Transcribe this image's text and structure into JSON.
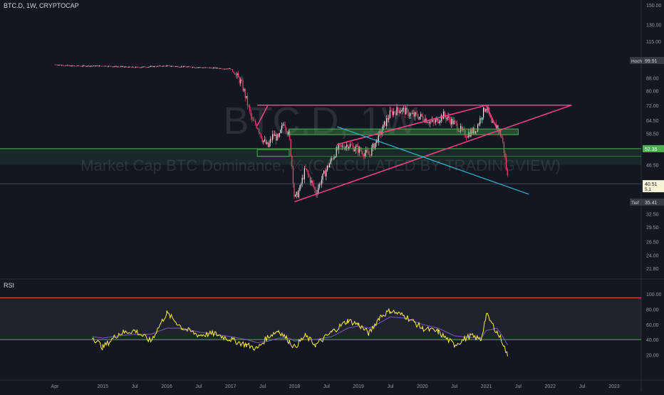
{
  "header": {
    "symbol": "BTC.D, 1W, CRYPTOCAP"
  },
  "watermark": {
    "big": "BTC.D, 1W",
    "sub": "Market Cap BTC Dominance, % (CALCULATED BY TRADINGVIEW)"
  },
  "rsi_label": "RSI",
  "price_badges": {
    "high_label": "Hoch",
    "high_value": "99.91",
    "level_value": "52.36",
    "last_value": "40.51",
    "last_extra": "5.1",
    "low_label": "Tief",
    "low_value": "35.41"
  },
  "colors": {
    "background": "#131722",
    "candle_up": "#e6e6e6",
    "candle_down": "#f6466e",
    "trendline_pink": "#ff3f8e",
    "trendline_blue": "#31b4d8",
    "support_green": "#4caf50",
    "rsi_line": "#ffeb3b",
    "rsi_ma": "#7e57c2",
    "rsi_upper": "#ff5252",
    "rsi_lower": "#4caf50"
  },
  "chart_data": [
    {
      "type": "line",
      "name": "BTC.D weekly",
      "x_ticks": [
        "Apr",
        "2015",
        "Jul",
        "2016",
        "Jul",
        "2017",
        "Jul",
        "2018",
        "Jul",
        "2019",
        "Jul",
        "2020",
        "Jul",
        "2021",
        "Jul",
        "2022",
        "Jul",
        "2023"
      ],
      "y_ticks": [
        150.0,
        130.0,
        115.0,
        99.91,
        88.0,
        80.0,
        72.0,
        64.5,
        58.5,
        52.36,
        46.5,
        40.51,
        35.41,
        32.5,
        29.5,
        26.5,
        24.0,
        21.8
      ],
      "y_scale": "log",
      "x": [
        "2014-04",
        "2014-07",
        "2015-01",
        "2015-07",
        "2016-01",
        "2016-07",
        "2017-01",
        "2017-03",
        "2017-05",
        "2017-06",
        "2017-07",
        "2017-08",
        "2017-09",
        "2017-10",
        "2017-11",
        "2017-12",
        "2018-01",
        "2018-02",
        "2018-03",
        "2018-05",
        "2018-07",
        "2018-09",
        "2018-11",
        "2019-01",
        "2019-03",
        "2019-05",
        "2019-07",
        "2019-09",
        "2019-11",
        "2020-01",
        "2020-03",
        "2020-05",
        "2020-07",
        "2020-09",
        "2020-11",
        "2021-01",
        "2021-02",
        "2021-03",
        "2021-04",
        "2021-05"
      ],
      "y": [
        97,
        96,
        96,
        95,
        96,
        95,
        94,
        85,
        64,
        62,
        56,
        53,
        58,
        56,
        64,
        57,
        36,
        39,
        45,
        38,
        45,
        52,
        54,
        52,
        50,
        58,
        68,
        70,
        67,
        66,
        63,
        67,
        63,
        58,
        60,
        72,
        62,
        62,
        56,
        42
      ],
      "resistance_top": 72,
      "zone_upper": 60.5,
      "zone_lower": 52.36,
      "grid": false
    },
    {
      "type": "line",
      "name": "RSI",
      "y_ticks": [
        100,
        80,
        60,
        40,
        20
      ],
      "ylim": [
        0,
        100
      ],
      "upper_band": 95,
      "lower_band": 40,
      "x": [
        "2014-11",
        "2015-01",
        "2015-04",
        "2015-07",
        "2015-10",
        "2016-01",
        "2016-04",
        "2016-07",
        "2016-10",
        "2017-01",
        "2017-04",
        "2017-06",
        "2017-08",
        "2017-10",
        "2017-12",
        "2018-01",
        "2018-03",
        "2018-05",
        "2018-08",
        "2018-11",
        "2019-01",
        "2019-03",
        "2019-05",
        "2019-07",
        "2019-10",
        "2020-01",
        "2020-04",
        "2020-07",
        "2020-10",
        "2020-12",
        "2021-01",
        "2021-03",
        "2021-04",
        "2021-05"
      ],
      "y": [
        44,
        30,
        48,
        52,
        38,
        75,
        55,
        46,
        48,
        40,
        33,
        28,
        44,
        52,
        38,
        30,
        45,
        33,
        50,
        65,
        60,
        48,
        70,
        78,
        70,
        55,
        50,
        33,
        45,
        40,
        73,
        50,
        38,
        18
      ],
      "ma_y": [
        44,
        42,
        45,
        47,
        47,
        55,
        55,
        50,
        47,
        44,
        40,
        36,
        38,
        42,
        42,
        38,
        40,
        40,
        44,
        55,
        58,
        55,
        62,
        70,
        68,
        60,
        55,
        45,
        43,
        42,
        52,
        55,
        45,
        33
      ]
    }
  ]
}
